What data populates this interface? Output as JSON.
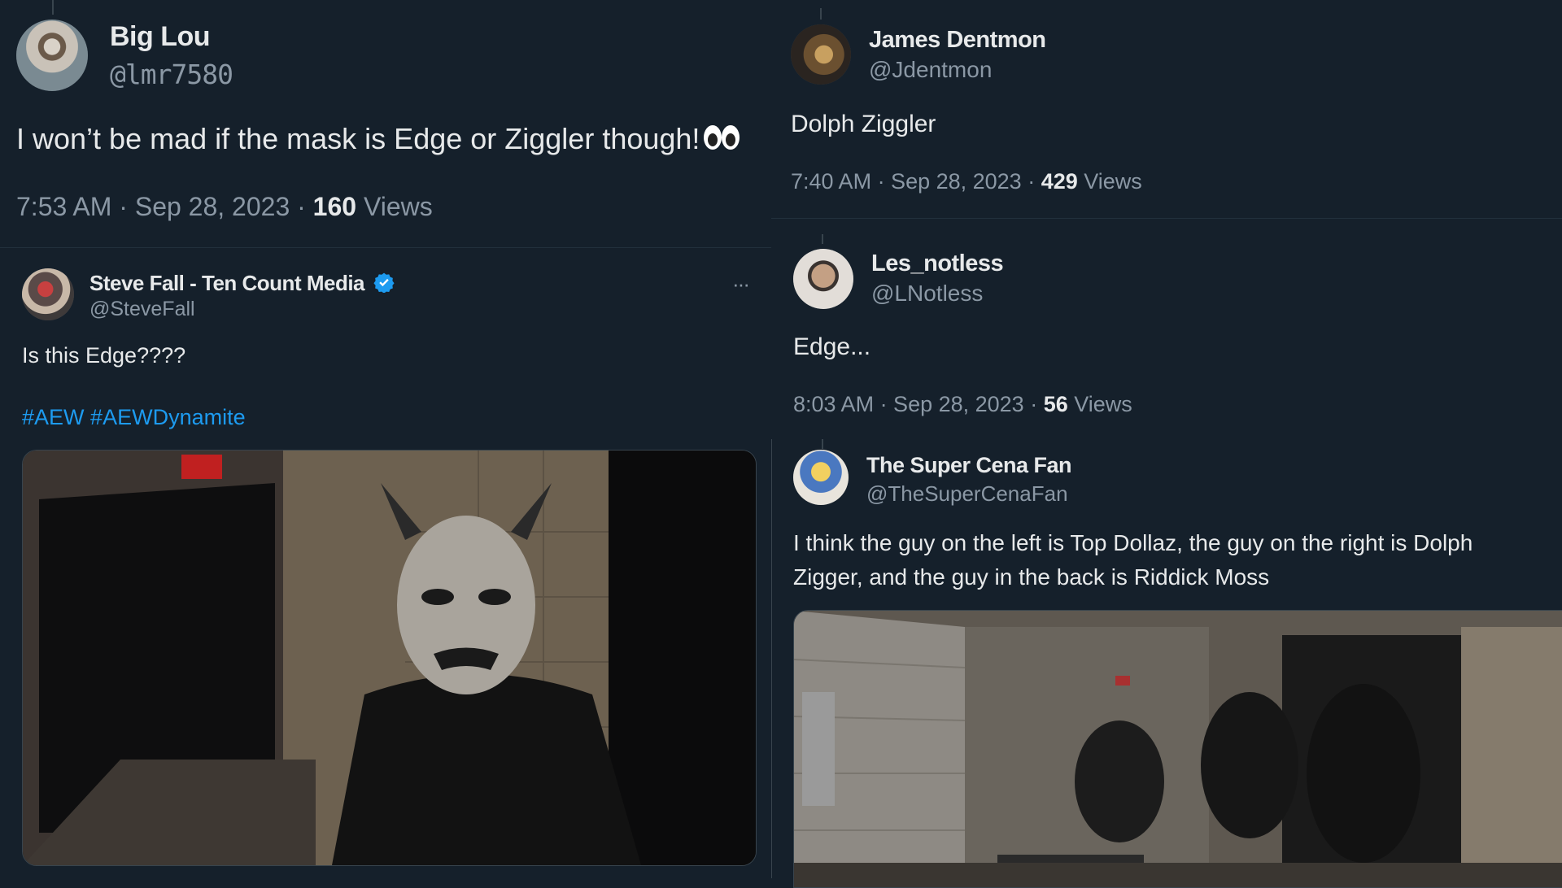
{
  "tweets": [
    {
      "name": "Big Lou",
      "handle": "@lmr7580",
      "text": "I won’t be mad if the mask is Edge or Ziggler though!",
      "emoji": "eyes-emoji",
      "time": "7:53 AM · Sep 28, 2023 · ",
      "views_count": "160",
      "views_label": " Views"
    },
    {
      "name": "Steve Fall - Ten Count Media",
      "handle": "@SteveFall",
      "verified": "verified-badge-icon",
      "more_label": "···",
      "text": "Is this Edge????",
      "hashtags": [
        "#AEW",
        "#AEWDynamite"
      ],
      "media": "masked-figure-hallway-image"
    },
    {
      "name": "James Dentmon",
      "handle": "@Jdentmon",
      "text": "Dolph Ziggler",
      "time": "7:40 AM · Sep 28, 2023 · ",
      "views_count": "429",
      "views_label": " Views"
    },
    {
      "name": "Les_notless",
      "handle": "@LNotless",
      "text": "Edge...",
      "time": "8:03 AM · Sep 28, 2023 · ",
      "views_count": "56",
      "views_label": " Views"
    },
    {
      "name": "The Super Cena Fan",
      "handle": "@TheSuperCenaFan",
      "text_line1": "I think the guy on the left is Top Dollaz, the guy on the right is Dolph",
      "text_line2": "Zigger, and the guy in the back is Riddick Moss",
      "media": "backstage-fight-image"
    }
  ],
  "colors": {
    "background": "#15202b",
    "text": "#e7e9ea",
    "secondary": "#8b98a5",
    "link": "#1d9bf0",
    "border": "#38444d"
  }
}
